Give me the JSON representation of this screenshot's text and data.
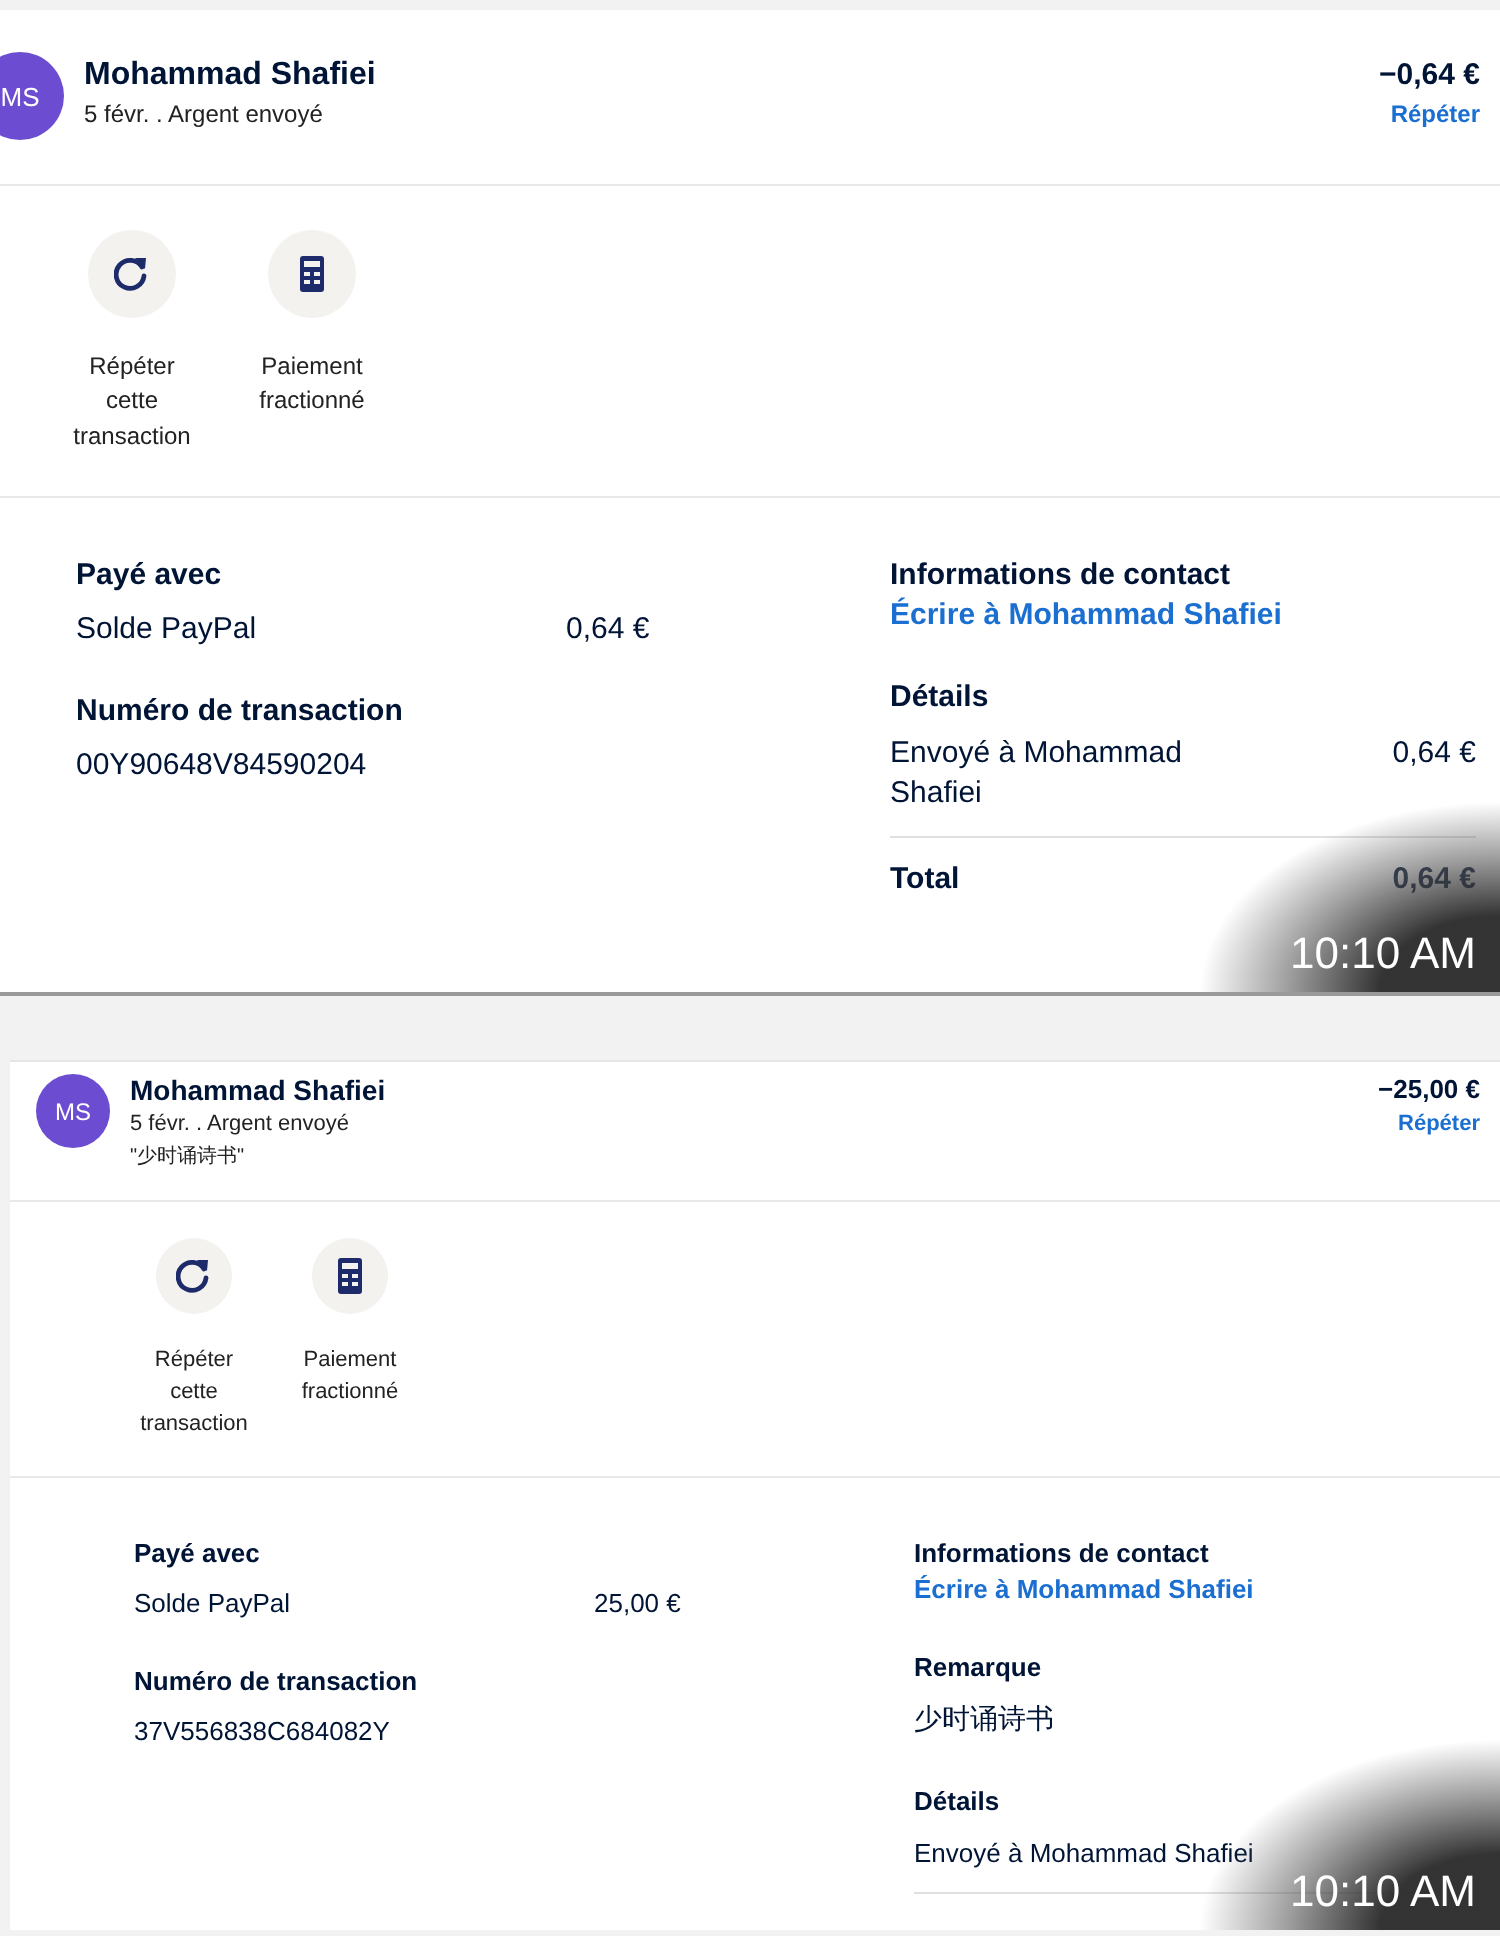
{
  "shots": [
    {
      "avatar": "MS",
      "name": "Mohammad Shafiei",
      "subtitle": "5 févr. . Argent envoyé",
      "amount": "−0,64 €",
      "repeat_link": "Répéter",
      "actions": [
        {
          "kind": "repeat",
          "label": "Répéter cette transaction"
        },
        {
          "kind": "split",
          "label": "Paiement fractionné"
        }
      ],
      "paid_with": {
        "heading": "Payé avec",
        "method": "Solde PayPal",
        "amount": "0,64 €"
      },
      "transaction": {
        "heading": "Numéro de transaction",
        "id": "00Y90648V84590204"
      },
      "contact": {
        "heading": "Informations de contact",
        "link": "Écrire à Mohammad Shafiei"
      },
      "details": {
        "heading": "Détails",
        "lines": [
          {
            "label": "Envoyé à Mohammad Shafiei",
            "amount": "0,64 €"
          }
        ],
        "total": {
          "label": "Total",
          "amount": "0,64 €"
        }
      },
      "timestamp": "10:10 AM"
    },
    {
      "avatar": "MS",
      "name": "Mohammad Shafiei",
      "subtitle": "5 févr. . Argent envoyé",
      "note": "\"少时诵诗书\"",
      "amount": "−25,00 €",
      "repeat_link": "Répéter",
      "actions": [
        {
          "kind": "repeat",
          "label": "Répéter cette transaction"
        },
        {
          "kind": "split",
          "label": "Paiement fractionné"
        }
      ],
      "paid_with": {
        "heading": "Payé avec",
        "method": "Solde PayPal",
        "amount": "25,00 €"
      },
      "transaction": {
        "heading": "Numéro de transaction",
        "id": "37V556838C684082Y"
      },
      "contact": {
        "heading": "Informations de contact",
        "link": "Écrire à Mohammad Shafiei"
      },
      "remark": {
        "heading": "Remarque",
        "text": "少时诵诗书"
      },
      "details": {
        "heading": "Détails",
        "lines": [
          {
            "label": "Envoyé à Mohammad Shafiei"
          }
        ]
      },
      "timestamp": "10:10 AM"
    }
  ]
}
